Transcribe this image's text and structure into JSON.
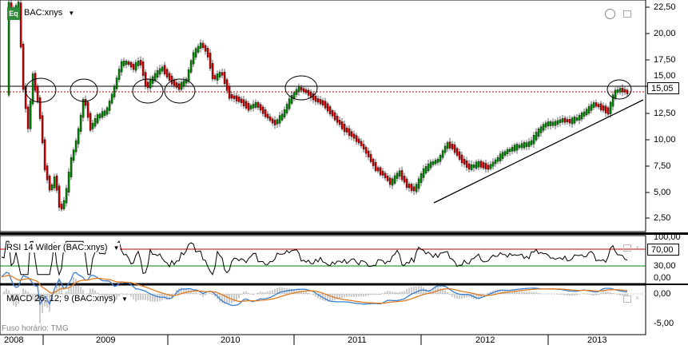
{
  "symbol": "BAC:xnys",
  "logo_text": "Eq",
  "price_axis": [
    "22,50",
    "20,00",
    "17,50",
    "15,00",
    "12,50",
    "10,00",
    "7,50",
    "5,00",
    "2,50"
  ],
  "last_price": "15,05",
  "rsi": {
    "title": "RSI 14 Wilder (BAC:xnys)",
    "axis": [
      "100,00",
      "70,00",
      "30,00",
      "0,00"
    ],
    "upper_level": 70,
    "lower_level": 30,
    "colors": {
      "upper": "#c00000",
      "lower": "#008000",
      "line": "#000000"
    }
  },
  "macd": {
    "title": "MACD 26; 12; 9 (BAC:xnys)",
    "axis": [
      "0,00",
      "-5,00"
    ],
    "colors": {
      "macd": "#3a7fd0",
      "signal": "#e07a20",
      "hist": "#444444"
    }
  },
  "timezone_label": "Fuso horário: TMG",
  "years": [
    "2008",
    "2009",
    "2010",
    "2011",
    "2012",
    "2013"
  ],
  "colors": {
    "up": "#008000",
    "down": "#c00000",
    "reference_line": "#000000",
    "dotted": "#c00000"
  }
}
